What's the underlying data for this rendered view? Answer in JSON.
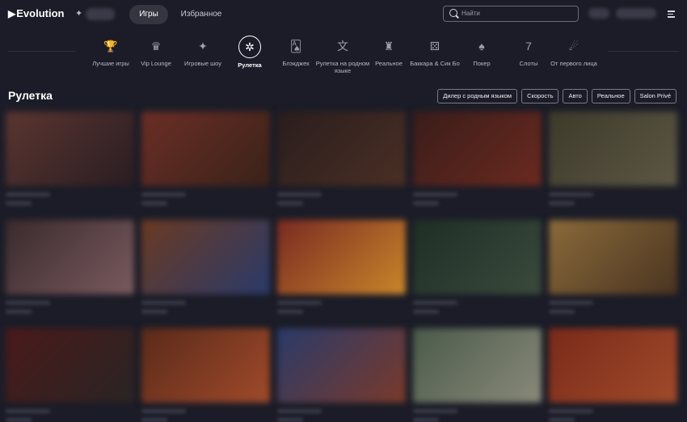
{
  "header": {
    "logo": "Evolution",
    "tabs": [
      {
        "label": "Игры",
        "active": true
      },
      {
        "label": "Избранное",
        "active": false
      }
    ],
    "search_placeholder": "Найти"
  },
  "categories": [
    {
      "label": "Лучшие игры",
      "icon": "podium-icon",
      "glyph": "🏆",
      "active": false
    },
    {
      "label": "Vip Lounge",
      "icon": "vip-crown-icon",
      "glyph": "♛",
      "active": false
    },
    {
      "label": "Игровые шоу",
      "icon": "game-show-icon",
      "glyph": "✦",
      "active": false
    },
    {
      "label": "Рулетка",
      "icon": "roulette-wheel-icon",
      "glyph": "✲",
      "active": true
    },
    {
      "label": "Блэкджек",
      "icon": "blackjack-cards-icon",
      "glyph": "🂡",
      "active": false
    },
    {
      "label": "Рулетка на родном языке",
      "icon": "native-language-icon",
      "glyph": "文",
      "active": false
    },
    {
      "label": "Реальное",
      "icon": "real-casino-icon",
      "glyph": "♜",
      "active": false
    },
    {
      "label": "Баккара & Сик Бо",
      "icon": "dice-icon",
      "glyph": "⚄",
      "active": false
    },
    {
      "label": "Покер",
      "icon": "poker-cards-icon",
      "glyph": "♠",
      "active": false
    },
    {
      "label": "Слоты",
      "icon": "slot-machine-icon",
      "glyph": "7",
      "active": false
    },
    {
      "label": "От первого лица",
      "icon": "first-person-icon",
      "glyph": "☄",
      "active": false
    }
  ],
  "section": {
    "title": "Рулетка",
    "filters": [
      "Дилер с родным языком",
      "Скорость",
      "Авто",
      "Реальное",
      "Salon Privé"
    ]
  },
  "tiles": [
    {
      "colors": [
        "#5a3530",
        "#2a1d22"
      ]
    },
    {
      "colors": [
        "#6a2e25",
        "#3a2219"
      ]
    },
    {
      "colors": [
        "#2a1d1d",
        "#4a2f24"
      ]
    },
    {
      "colors": [
        "#3a1c1a",
        "#6a2a1f"
      ]
    },
    {
      "colors": [
        "#3e3a2a",
        "#5c5744"
      ]
    },
    {
      "colors": [
        "#3a2a2d",
        "#7a5a5e"
      ]
    },
    {
      "colors": [
        "#6a3a22",
        "#2a3a6a"
      ]
    },
    {
      "colors": [
        "#7a2a22",
        "#c9862a"
      ]
    },
    {
      "colors": [
        "#1f2e26",
        "#3a4a3c"
      ]
    },
    {
      "colors": [
        "#8a6a3a",
        "#4a3420"
      ]
    },
    {
      "colors": [
        "#4a1a1a",
        "#2a2424"
      ]
    },
    {
      "colors": [
        "#5a2a1a",
        "#a04a2a"
      ]
    },
    {
      "colors": [
        "#2a3a6a",
        "#7a3a2a"
      ]
    },
    {
      "colors": [
        "#4a5a4a",
        "#8a8a7a"
      ]
    },
    {
      "colors": [
        "#7a2a1a",
        "#a04a2a"
      ]
    }
  ]
}
